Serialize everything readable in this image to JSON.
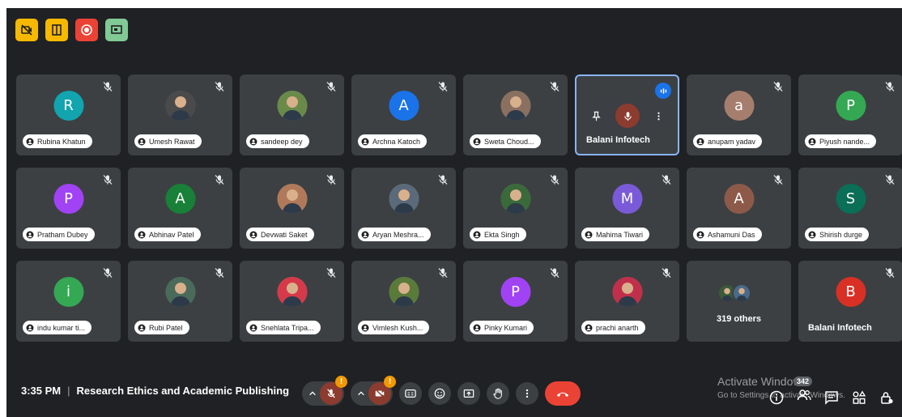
{
  "top_icons": [
    {
      "name": "camera-off-icon",
      "color": "#f6b900"
    },
    {
      "name": "door-exit-icon",
      "color": "#f6b900"
    },
    {
      "name": "record-icon",
      "color": "#ea4335"
    },
    {
      "name": "present-icon",
      "color": "#81c995"
    }
  ],
  "participants": [
    {
      "name": "Rubina Khatun",
      "initial": "R",
      "color": "#12a4af"
    },
    {
      "name": "Umesh Rawat",
      "photo": "#4a4a4a"
    },
    {
      "name": "sandeep dey",
      "photo": "#6a8a4a"
    },
    {
      "name": "Archna Katoch",
      "initial": "A",
      "color": "#1a73e8"
    },
    {
      "name": "Sweta Choud...",
      "photo": "#8a7060"
    },
    {
      "name": "Balani Infotech",
      "active": true
    },
    {
      "name": "anupam yadav",
      "initial": "a",
      "color": "#a67e6e"
    },
    {
      "name": "Piyush nande...",
      "initial": "P",
      "color": "#34a853"
    },
    {
      "name": "Pratham Dubey",
      "initial": "P",
      "color": "#a142f4"
    },
    {
      "name": "Abhinav Patel",
      "initial": "A",
      "color": "#188038"
    },
    {
      "name": "Devwati Saket",
      "photo": "#b07a5a"
    },
    {
      "name": "Aryan Meshra...",
      "photo": "#5a6a7a"
    },
    {
      "name": "Ekta Singh",
      "photo": "#3a6a3a"
    },
    {
      "name": "Mahima Tiwari",
      "initial": "M",
      "color": "#7a5ad8"
    },
    {
      "name": "Ashamuni Das",
      "initial": "A",
      "color": "#8d5a4a"
    },
    {
      "name": "Shirish durge",
      "initial": "S",
      "color": "#0b6e57"
    },
    {
      "name": "indu kumar ti...",
      "initial": "i",
      "color": "#34a853"
    },
    {
      "name": "Rubi Patel",
      "photo": "#4a6a5a"
    },
    {
      "name": "Snehlata Tripa...",
      "photo": "#d63a4a"
    },
    {
      "name": "Vimlesh Kush...",
      "photo": "#5a7a3a"
    },
    {
      "name": "Pinky Kumari",
      "initial": "P",
      "color": "#a142f4"
    },
    {
      "name": "prachi anarth",
      "photo": "#c0304a"
    },
    {
      "name": "319 others",
      "others": true
    },
    {
      "name": "Balani Infotech",
      "initial": "B",
      "color": "#d93025",
      "plain": true
    }
  ],
  "bottom": {
    "time": "3:35 PM",
    "separator": "|",
    "meeting_title": "Research Ethics and Academic Publishing",
    "mic_badge": "!",
    "cam_badge": "!",
    "people_count": "342"
  },
  "watermark": {
    "line1": "Activate Windows",
    "line2": "Go to Settings to activate Windows."
  }
}
